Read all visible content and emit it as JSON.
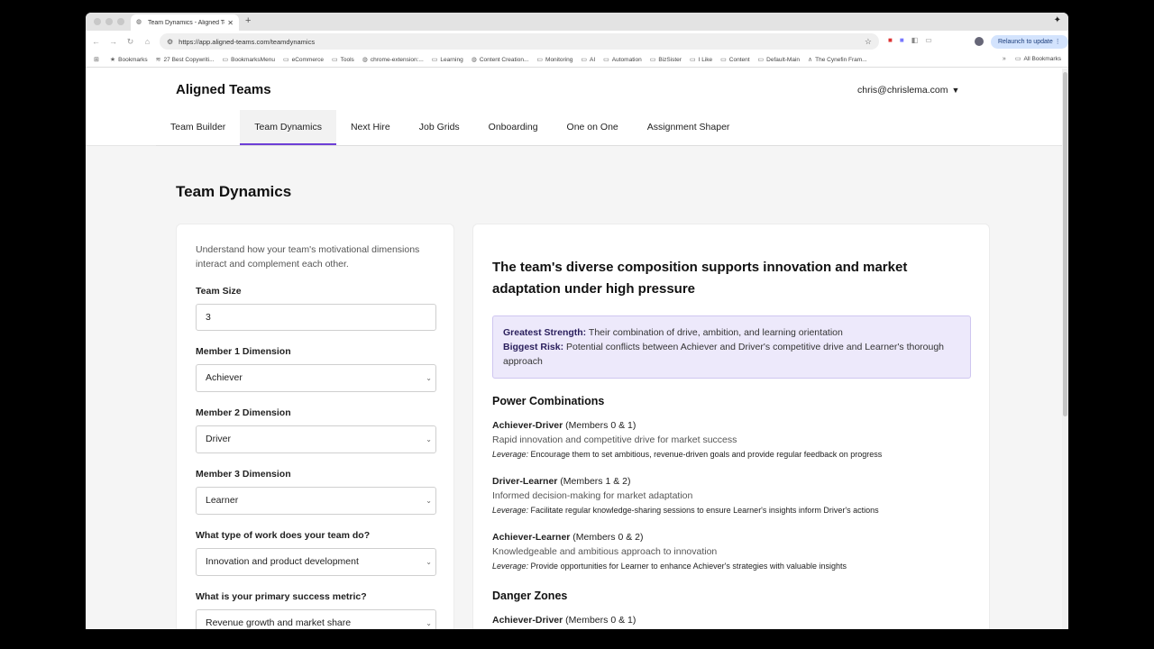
{
  "browser": {
    "tab_title": "Team Dynamics - Aligned Te...",
    "url": "https://app.aligned-teams.com/teamdynamics",
    "relaunch_label": "Relaunch to update",
    "bookmarks": [
      "Bookmarks",
      "27 Best Copywriti...",
      "BookmarksMenu",
      "eCommerce",
      "Tools",
      "chrome-extension:...",
      "Learning",
      "Content Creation...",
      "Monitoring",
      "AI",
      "Automation",
      "BizSister",
      "I Like",
      "Content",
      "Default-Main",
      "The Cynefin Fram..."
    ],
    "all_bookmarks": "All Bookmarks"
  },
  "header": {
    "brand": "Aligned Teams",
    "user_email": "chris@chrislema.com",
    "nav": [
      "Team Builder",
      "Team Dynamics",
      "Next Hire",
      "Job Grids",
      "Onboarding",
      "One on One",
      "Assignment Shaper"
    ],
    "active_nav": "Team Dynamics"
  },
  "page_title": "Team Dynamics",
  "form": {
    "intro": "Understand how your team's motivational dimensions interact and complement each other.",
    "team_size_label": "Team Size",
    "team_size_value": "3",
    "member1_label": "Member 1 Dimension",
    "member1_value": "Achiever",
    "member2_label": "Member 2 Dimension",
    "member2_value": "Driver",
    "member3_label": "Member 3 Dimension",
    "member3_value": "Learner",
    "work_type_label": "What type of work does your team do?",
    "work_type_value": "Innovation and product development",
    "metric_label": "What is your primary success metric?",
    "metric_value": "Revenue growth and market share"
  },
  "result": {
    "headline": "The team's diverse composition supports innovation and market adaptation under high pressure",
    "strength_label": "Greatest Strength:",
    "strength_text": "Their combination of drive, ambition, and learning orientation",
    "risk_label": "Biggest Risk:",
    "risk_text": "Potential conflicts between Achiever and Driver's competitive drive and Learner's thorough approach",
    "power_heading": "Power Combinations",
    "combos": [
      {
        "name": "Achiever-Driver",
        "members": "(Members 0 & 1)",
        "desc": "Rapid innovation and competitive drive for market success",
        "leverage_label": "Leverage:",
        "leverage": "Encourage them to set ambitious, revenue-driven goals and provide regular feedback on progress"
      },
      {
        "name": "Driver-Learner",
        "members": "(Members 1 & 2)",
        "desc": "Informed decision-making for market adaptation",
        "leverage_label": "Leverage:",
        "leverage": "Facilitate regular knowledge-sharing sessions to ensure Learner's insights inform Driver's actions"
      },
      {
        "name": "Achiever-Learner",
        "members": "(Members 0 & 2)",
        "desc": "Knowledgeable and ambitious approach to innovation",
        "leverage_label": "Leverage:",
        "leverage": "Provide opportunities for Learner to enhance Achiever's strategies with valuable insights"
      }
    ],
    "danger_heading": "Danger Zones",
    "danger_first": {
      "name": "Achiever-Driver",
      "members": "(Members 0 & 1)"
    }
  },
  "colors": {
    "accent": "#6d3fd6",
    "callout_bg": "#ede9fb"
  }
}
